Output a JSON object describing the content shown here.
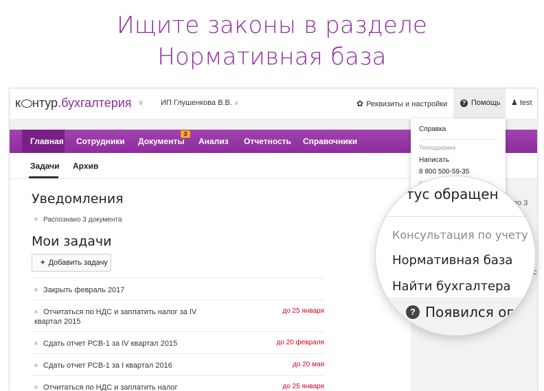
{
  "headline": {
    "line1": "Ищите законы в разделе",
    "line2": "Нормативная база"
  },
  "colors": {
    "brand": "#8e2c9b",
    "nav_active": "#7a1f86",
    "badge": "#f5a623",
    "due": "#d0021b"
  },
  "topbar": {
    "logo_part1": "к",
    "logo_part2": "нтур",
    "logo_part3": ".бухгалтерия",
    "org_name": "ИП Глушенкова В.В.",
    "settings_label": "Реквизиты и настройки",
    "help_label": "Помощь",
    "user_label": "test"
  },
  "nav": {
    "items": [
      "Главная",
      "Сотрудники",
      "Документы",
      "Анализ",
      "Отчетность",
      "Справочники"
    ],
    "documents_badge": "3"
  },
  "subtabs": [
    "Задачи",
    "Архив"
  ],
  "notifications": {
    "title": "Уведомления",
    "items": [
      "Распознано 3 документа"
    ]
  },
  "tasks": {
    "title": "Мои задачи",
    "add_label": "Добавить задачу",
    "items": [
      {
        "text": "Закрыть февраль 2017",
        "due": ""
      },
      {
        "text": "Отчитаться по НДС и заплатить налог за IV квартал 2015",
        "due": "до 25 января"
      },
      {
        "text": "Сдать отчет РСВ-1 за IV квартал 2015",
        "due": "до 20 февраля"
      },
      {
        "text": "Сдать отчет РСВ-1 за I квартал 2016",
        "due": "до 20 мая"
      },
      {
        "text": "Отчитаться по НДС и заплатить налог",
        "due": "до 25 января"
      }
    ]
  },
  "help_menu": {
    "reference": "Справка",
    "support_caption": "Техподдержка",
    "write": "Написать",
    "phone": "8 800 500-59-35",
    "cut_caption": "С... ...ия"
  },
  "peek": {
    "right_text": "» по 3",
    "right_text2": "с"
  },
  "magnifier": {
    "status_heading": "тус обращен",
    "consultation": "Консультация по учету",
    "normative_base": "Нормативная база",
    "find_accountant": "Найти бухгалтера",
    "appeared": "Появился ог"
  }
}
